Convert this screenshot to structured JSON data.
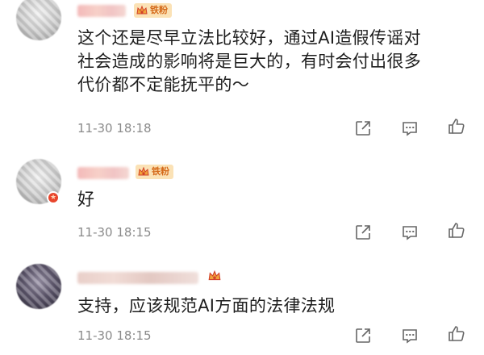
{
  "comments": [
    {
      "badge": "铁粉",
      "text_lines": [
        "这个还是尽早立法比较好，通过AI造假传谣对",
        "社会造成的影响将是巨大的，有时会付出很多",
        "代价都不定能抚平的～"
      ],
      "time": "11-30 18:18"
    },
    {
      "badge": "铁粉",
      "text_lines": [
        "好"
      ],
      "time": "11-30 18:15"
    },
    {
      "badge": "",
      "text_lines": [
        "支持，应该规范AI方面的法律法规"
      ],
      "time": "11-30 18:15"
    }
  ],
  "icons": {
    "forward": "share-icon",
    "comment": "comment-icon",
    "like": "like-icon"
  },
  "colors": {
    "badge_bg": "#fbe2b6",
    "badge_text": "#d56a1a",
    "time_text": "#8a8a8a",
    "verified_badge": "#e8452c"
  }
}
